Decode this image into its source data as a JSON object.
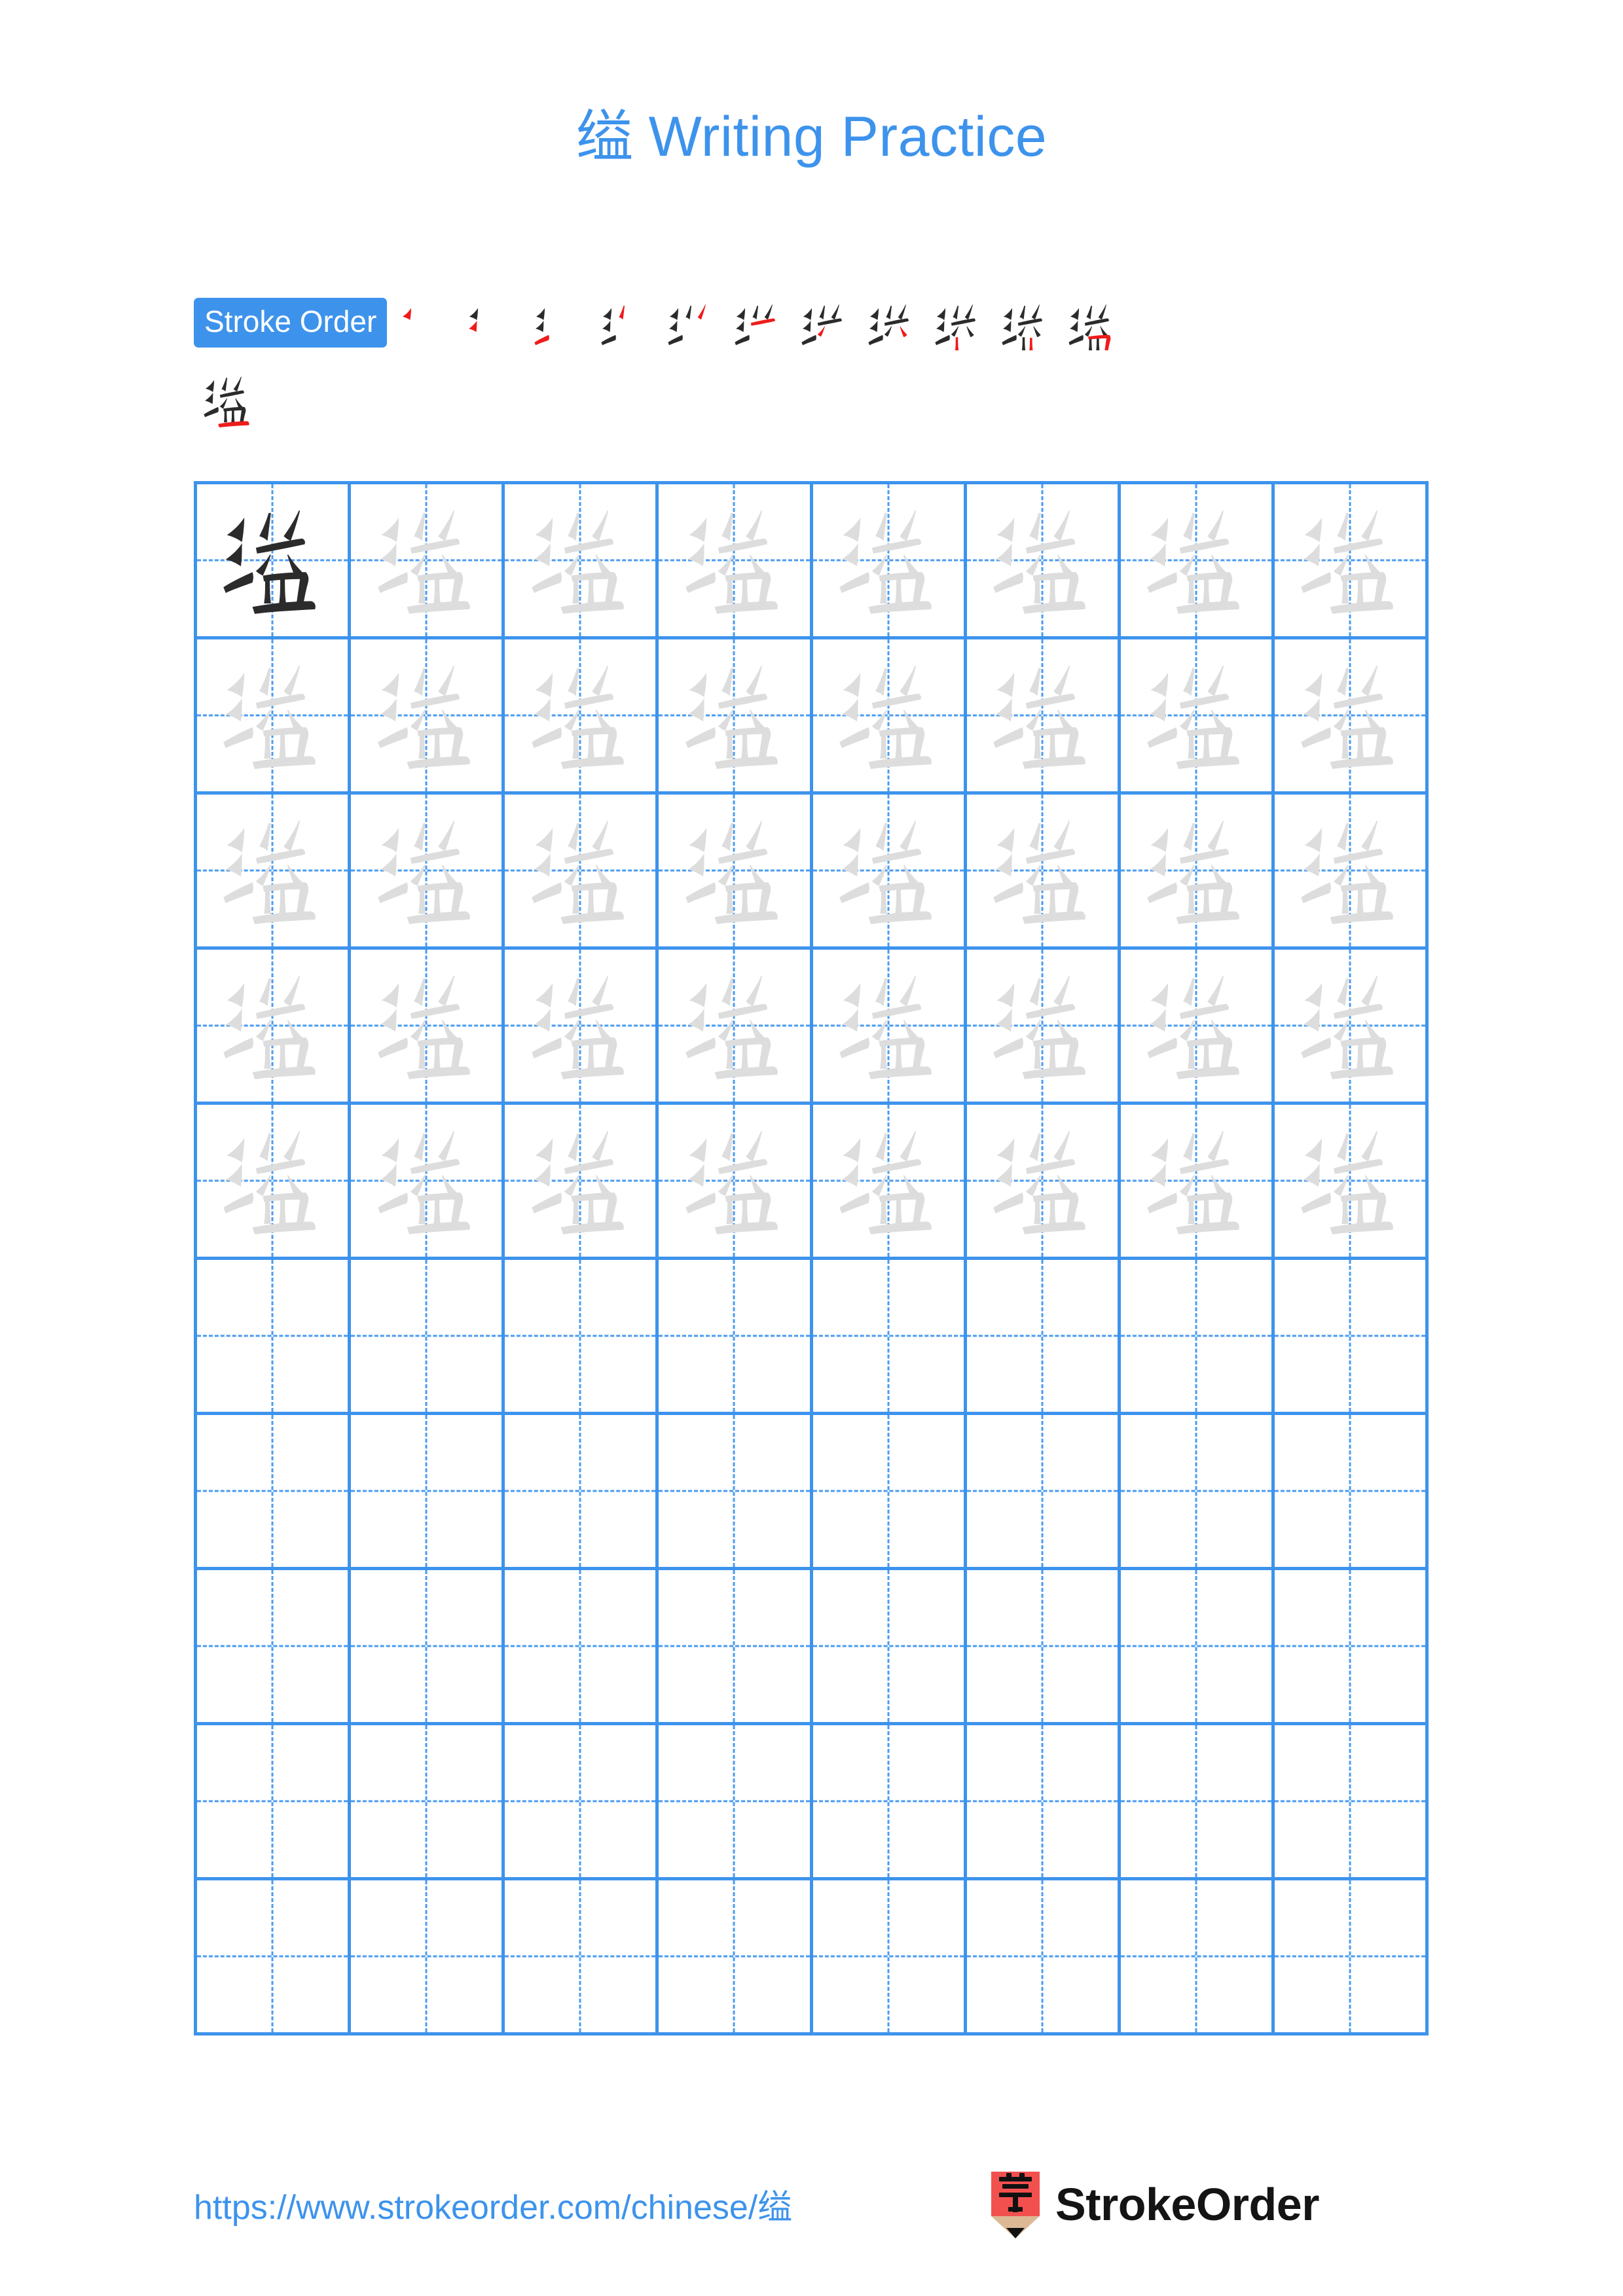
{
  "character": "缢",
  "title": {
    "character": "缢",
    "suffix": " Writing Practice",
    "color": "#3d93ec"
  },
  "stroke_order": {
    "badge_label": "Stroke Order",
    "badge_bg": "#3d93ec",
    "badge_text_color": "#ffffff",
    "total_strokes": 12,
    "new_stroke_color": "#ee1c1c",
    "existing_stroke_color": "#2b2b2b",
    "steps_line1": 11,
    "steps_line2": 1,
    "step_labels": [
      "stroke-1",
      "stroke-2",
      "stroke-3",
      "stroke-4",
      "stroke-5",
      "stroke-6",
      "stroke-7",
      "stroke-8",
      "stroke-9",
      "stroke-10",
      "stroke-11",
      "stroke-12"
    ]
  },
  "grid": {
    "columns": 8,
    "rows": 10,
    "filled_rows": 5,
    "empty_rows": 5,
    "line_color": "#3d93ec",
    "guide_color": "#4a9bf0",
    "model_char_color": "#2b2b2b",
    "trace_char_color": "#dddddd",
    "cells": [
      [
        "model",
        "trace",
        "trace",
        "trace",
        "trace",
        "trace",
        "trace",
        "trace"
      ],
      [
        "trace",
        "trace",
        "trace",
        "trace",
        "trace",
        "trace",
        "trace",
        "trace"
      ],
      [
        "trace",
        "trace",
        "trace",
        "trace",
        "trace",
        "trace",
        "trace",
        "trace"
      ],
      [
        "trace",
        "trace",
        "trace",
        "trace",
        "trace",
        "trace",
        "trace",
        "trace"
      ],
      [
        "trace",
        "trace",
        "trace",
        "trace",
        "trace",
        "trace",
        "trace",
        "trace"
      ],
      [
        "empty",
        "empty",
        "empty",
        "empty",
        "empty",
        "empty",
        "empty",
        "empty"
      ],
      [
        "empty",
        "empty",
        "empty",
        "empty",
        "empty",
        "empty",
        "empty",
        "empty"
      ],
      [
        "empty",
        "empty",
        "empty",
        "empty",
        "empty",
        "empty",
        "empty",
        "empty"
      ],
      [
        "empty",
        "empty",
        "empty",
        "empty",
        "empty",
        "empty",
        "empty",
        "empty"
      ],
      [
        "empty",
        "empty",
        "empty",
        "empty",
        "empty",
        "empty",
        "empty",
        "empty"
      ]
    ]
  },
  "footer": {
    "url": "https://www.strokeorder.com/chinese/缢",
    "url_color": "#3d93ec",
    "brand_name": "StrokeOrder",
    "logo_char": "字",
    "logo_bg": "#f2504f",
    "logo_wood": "#dcb994",
    "logo_tip": "#111111"
  }
}
